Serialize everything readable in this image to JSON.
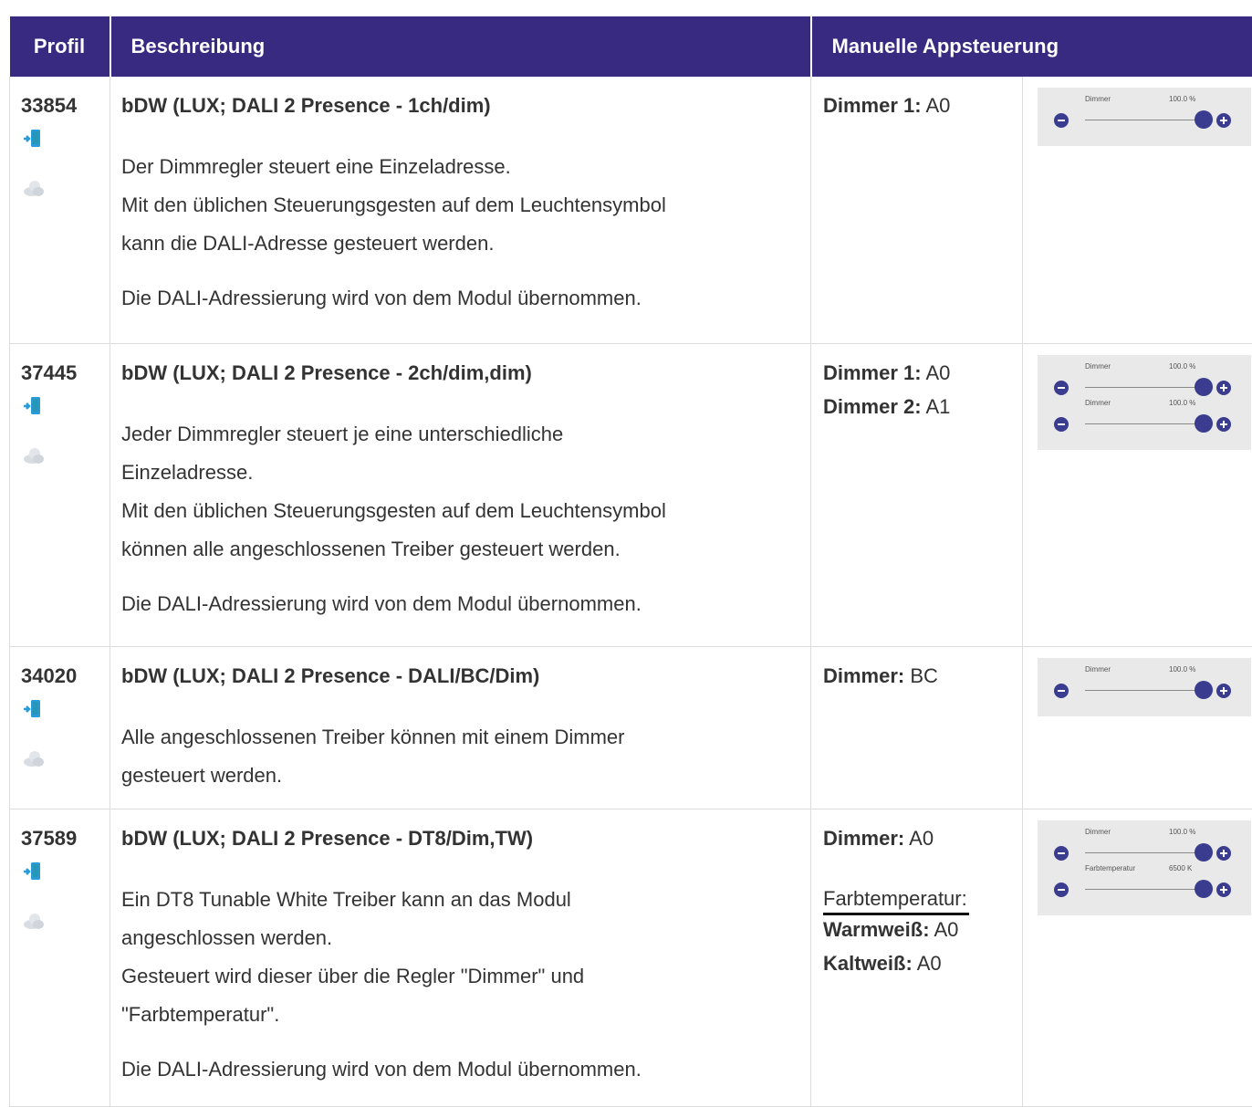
{
  "table": {
    "headers": [
      "Profil",
      "Beschreibung",
      "Manuelle Appsteuerung"
    ],
    "rows": [
      {
        "profile": "33854",
        "title": "bDW (LUX; DALI 2 Presence - 1ch/dim)",
        "paragraphs": [
          [
            "Der Dimmregler steuert eine Einzeladresse.",
            "Mit den üblichen Steuerungsgesten auf dem Leuchtensymbol",
            "kann die DALI-Adresse gesteuert werden."
          ],
          [
            "Die DALI-Adressierung wird von dem Modul übernommen."
          ]
        ],
        "manual": [
          {
            "label": "Dimmer 1:",
            "value": "A0"
          }
        ],
        "sliders": [
          {
            "label": "Dimmer",
            "value": "100.0 %",
            "level": 1.0
          }
        ]
      },
      {
        "profile": "37445",
        "title": "bDW (LUX; DALI 2 Presence - 2ch/dim,dim)",
        "paragraphs": [
          [
            "Jeder Dimmregler steuert je eine unterschiedliche",
            "Einzeladresse.",
            "Mit den üblichen Steuerungsgesten auf dem Leuchtensymbol",
            "können alle angeschlossenen Treiber gesteuert werden."
          ],
          [
            "Die DALI-Adressierung wird von dem Modul übernommen."
          ]
        ],
        "manual": [
          {
            "label": "Dimmer 1:",
            "value": "A0"
          },
          {
            "label": "Dimmer 2:",
            "value": "A1"
          }
        ],
        "sliders": [
          {
            "label": "Dimmer",
            "value": "100.0 %",
            "level": 1.0
          },
          {
            "label": "Dimmer",
            "value": "100.0 %",
            "level": 1.0
          }
        ]
      },
      {
        "profile": "34020",
        "title": "bDW (LUX; DALI 2 Presence - DALI/BC/Dim)",
        "paragraphs": [
          [
            "Alle angeschlossenen Treiber können mit einem Dimmer",
            "gesteuert werden."
          ]
        ],
        "manual": [
          {
            "label": "Dimmer:",
            "value": "BC"
          }
        ],
        "sliders": [
          {
            "label": "Dimmer",
            "value": "100.0 %",
            "level": 1.0
          }
        ]
      },
      {
        "profile": "37589",
        "title": "bDW (LUX; DALI 2 Presence - DT8/Dim,TW)",
        "paragraphs": [
          [
            "Ein DT8 Tunable White Treiber kann an das Modul",
            "angeschlossen werden.",
            "Gesteuert wird dieser über die Regler \"Dimmer\" und",
            "\"Farbtemperatur\"."
          ],
          [
            "Die DALI-Adressierung wird von dem Modul übernommen."
          ]
        ],
        "manual": [
          {
            "label": "Dimmer:",
            "value": "A0"
          }
        ],
        "manual_heading": "Farbtemperatur:",
        "manual_extra": [
          {
            "label": "Warmweiß:",
            "value": "A0"
          },
          {
            "label": "Kaltweiß:",
            "value": "A0"
          }
        ],
        "sliders": [
          {
            "label": "Dimmer",
            "value": "100.0 %",
            "level": 1.0
          },
          {
            "label": "Farbtemperatur",
            "value": "6500 K",
            "level": 1.0
          }
        ]
      }
    ]
  },
  "icons": {
    "app": "smartphone-app-icon",
    "cloud": "cloud-icon"
  },
  "colors": {
    "header_bg": "#372a80",
    "slider_accent": "#3a3d8f",
    "panel_bg": "#e9e9e9",
    "phone_blue": "#2a9bd8"
  }
}
